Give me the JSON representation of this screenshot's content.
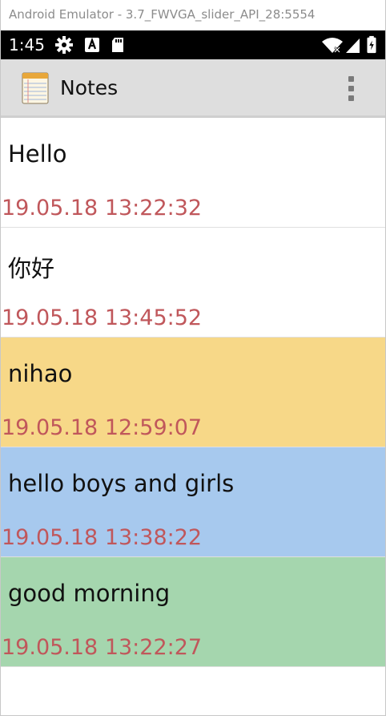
{
  "window": {
    "title": "Android Emulator - 3.7_FWVGA_slider_API_28:5554"
  },
  "status_bar": {
    "time": "1:45",
    "icons": [
      "settings-icon",
      "accessibility-icon",
      "sd-card-icon",
      "wifi-icon",
      "cell-signal-icon",
      "battery-icon"
    ]
  },
  "app_bar": {
    "icon": "notepad-icon",
    "title": "Notes",
    "menu_icon": "overflow-menu-icon"
  },
  "notes": [
    {
      "title": "Hello",
      "date": "19.05.18 13:22:32",
      "background": "#ffffff"
    },
    {
      "title": "你好",
      "date": "19.05.18 13:45:52",
      "background": "#ffffff"
    },
    {
      "title": "nihao",
      "date": "19.05.18 12:59:07",
      "background": "#f7d888"
    },
    {
      "title": "hello boys and girls",
      "date": "19.05.18 13:38:22",
      "background": "#a7c9ee"
    },
    {
      "title": "good morning",
      "date": "19.05.18 13:22:27",
      "background": "#a5d6ae"
    }
  ],
  "colors": {
    "date_text": "#c0575b",
    "app_bar": "#dedede",
    "status_bar": "#000000"
  }
}
